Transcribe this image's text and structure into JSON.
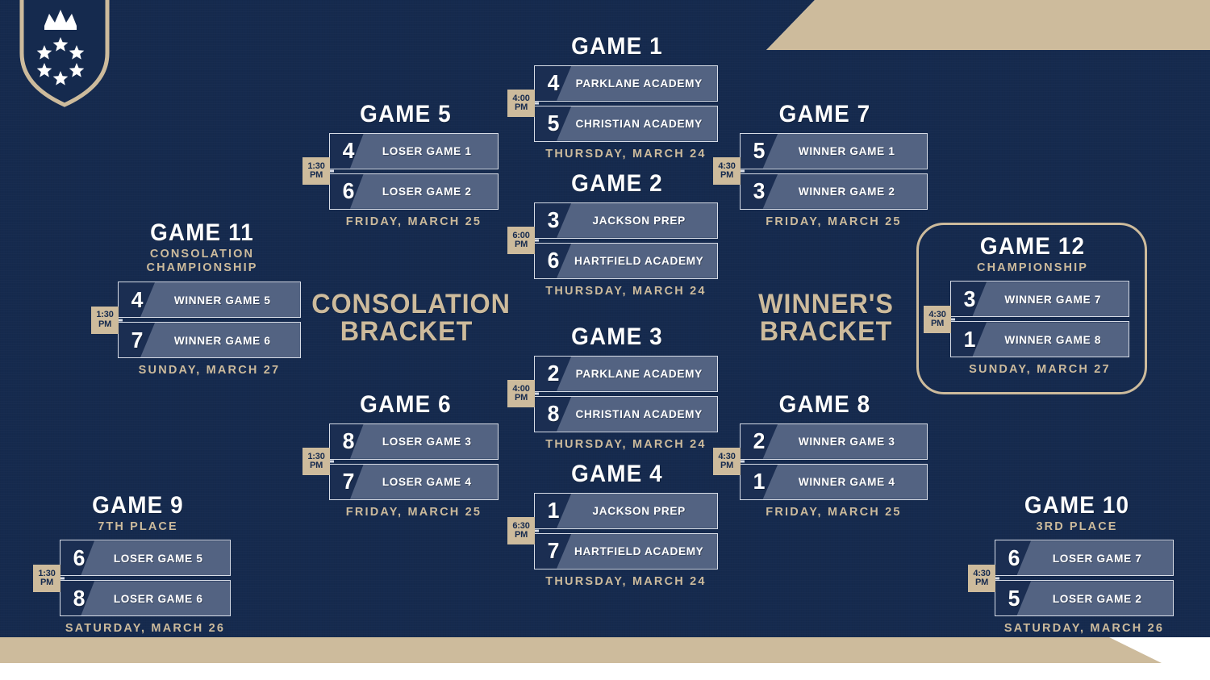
{
  "brand": {
    "logo_icon": "shield-crown-stars-logo",
    "navy": "#152a4e",
    "gold": "#cdbb9c",
    "slate": "#536382",
    "row_dark": "#1b2e52",
    "row_border": "#d7dce6"
  },
  "labels": {
    "consolation_bracket": "CONSOLATION\nBRACKET",
    "winners_bracket": "WINNER'S\nBRACKET"
  },
  "games": [
    {
      "id": "game-1",
      "title": "GAME 1",
      "subtitle": "",
      "time_line1": "4:00",
      "time_line2": "PM",
      "date": "THURSDAY, MARCH 24",
      "rows": [
        {
          "seed": "4",
          "team": "PARKLANE ACADEMY"
        },
        {
          "seed": "5",
          "team": "CHRISTIAN ACADEMY"
        }
      ]
    },
    {
      "id": "game-2",
      "title": "GAME 2",
      "subtitle": "",
      "time_line1": "6:00",
      "time_line2": "PM",
      "date": "THURSDAY, MARCH 24",
      "rows": [
        {
          "seed": "3",
          "team": "JACKSON PREP"
        },
        {
          "seed": "6",
          "team": "HARTFIELD ACADEMY"
        }
      ]
    },
    {
      "id": "game-3",
      "title": "GAME 3",
      "subtitle": "",
      "time_line1": "4:00",
      "time_line2": "PM",
      "date": "THURSDAY, MARCH 24",
      "rows": [
        {
          "seed": "2",
          "team": "PARKLANE ACADEMY"
        },
        {
          "seed": "8",
          "team": "CHRISTIAN ACADEMY"
        }
      ]
    },
    {
      "id": "game-4",
      "title": "GAME 4",
      "subtitle": "",
      "time_line1": "6:30",
      "time_line2": "PM",
      "date": "THURSDAY, MARCH 24",
      "rows": [
        {
          "seed": "1",
          "team": "JACKSON PREP"
        },
        {
          "seed": "7",
          "team": "HARTFIELD ACADEMY"
        }
      ]
    },
    {
      "id": "game-5",
      "title": "GAME 5",
      "subtitle": "",
      "time_line1": "1:30",
      "time_line2": "PM",
      "date": "FRIDAY, MARCH 25",
      "rows": [
        {
          "seed": "4",
          "team": "LOSER GAME 1"
        },
        {
          "seed": "6",
          "team": "LOSER GAME 2"
        }
      ]
    },
    {
      "id": "game-6",
      "title": "GAME 6",
      "subtitle": "",
      "time_line1": "1:30",
      "time_line2": "PM",
      "date": "FRIDAY, MARCH 25",
      "rows": [
        {
          "seed": "8",
          "team": "LOSER GAME 3"
        },
        {
          "seed": "7",
          "team": "LOSER GAME 4"
        }
      ]
    },
    {
      "id": "game-7",
      "title": "GAME 7",
      "subtitle": "",
      "time_line1": "4:30",
      "time_line2": "PM",
      "date": "FRIDAY, MARCH 25",
      "rows": [
        {
          "seed": "5",
          "team": "WINNER GAME 1"
        },
        {
          "seed": "3",
          "team": "WINNER GAME 2"
        }
      ]
    },
    {
      "id": "game-8",
      "title": "GAME 8",
      "subtitle": "",
      "time_line1": "4:30",
      "time_line2": "PM",
      "date": "FRIDAY, MARCH 25",
      "rows": [
        {
          "seed": "2",
          "team": "WINNER GAME 3"
        },
        {
          "seed": "1",
          "team": "WINNER GAME 4"
        }
      ]
    },
    {
      "id": "game-9",
      "title": "GAME 9",
      "subtitle": "7TH PLACE",
      "time_line1": "1:30",
      "time_line2": "PM",
      "date": "SATURDAY, MARCH 26",
      "rows": [
        {
          "seed": "6",
          "team": "LOSER GAME 5"
        },
        {
          "seed": "8",
          "team": "LOSER GAME 6"
        }
      ]
    },
    {
      "id": "game-10",
      "title": "GAME 10",
      "subtitle": "3RD PLACE",
      "time_line1": "4:30",
      "time_line2": "PM",
      "date": "SATURDAY, MARCH 26",
      "rows": [
        {
          "seed": "6",
          "team": "LOSER GAME 7"
        },
        {
          "seed": "5",
          "team": "LOSER GAME 2"
        }
      ]
    },
    {
      "id": "game-11",
      "title": "GAME 11",
      "subtitle": "CONSOLATION\nCHAMPIONSHIP",
      "time_line1": "1:30",
      "time_line2": "PM",
      "date": "SUNDAY, MARCH 27",
      "rows": [
        {
          "seed": "4",
          "team": "WINNER GAME 5"
        },
        {
          "seed": "7",
          "team": "WINNER GAME 6"
        }
      ]
    },
    {
      "id": "game-12",
      "title": "GAME 12",
      "subtitle": "CHAMPIONSHIP",
      "time_line1": "4:30",
      "time_line2": "PM",
      "date": "SUNDAY, MARCH 27",
      "rows": [
        {
          "seed": "3",
          "team": "WINNER GAME 7"
        },
        {
          "seed": "1",
          "team": "WINNER GAME 8"
        }
      ]
    }
  ]
}
